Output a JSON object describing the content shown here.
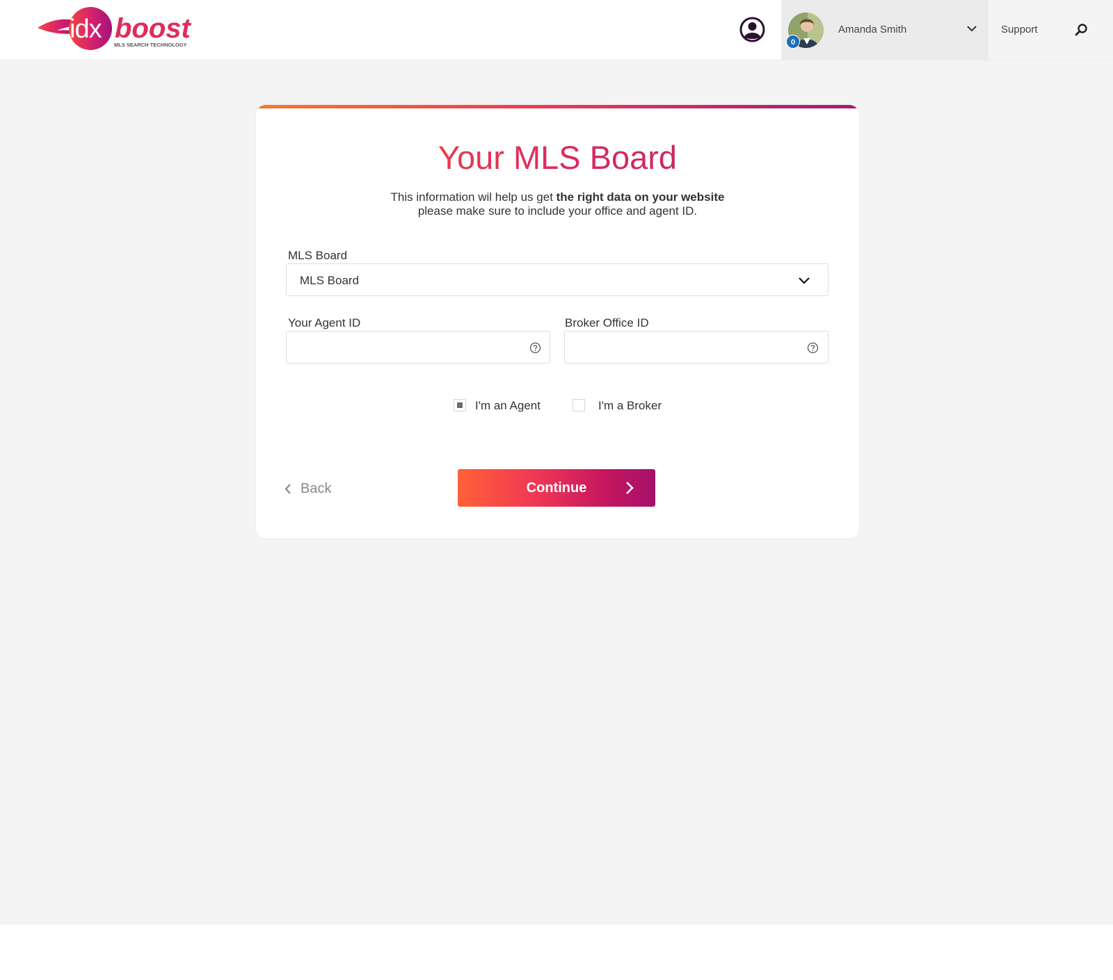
{
  "header": {
    "logo": {
      "wordmark_left": "idx",
      "wordmark_right": "boost",
      "tagline": "MLS SEARCH TECHNOLOGY"
    },
    "account_icon": "user-circle-icon",
    "user": {
      "name": "Amanda Smith",
      "notification_count": "0"
    },
    "support_label": "Support",
    "search_icon": "search-icon"
  },
  "card": {
    "title": "Your MLS Board",
    "description_part1": "This information wil help us get ",
    "description_bold": "the right data on your website",
    "description_line2": "please make sure to include your office and agent ID.",
    "mls_board": {
      "label": "MLS Board",
      "selected": "MLS Board"
    },
    "agent_id": {
      "label": "Your Agent ID",
      "value": ""
    },
    "broker_office_id": {
      "label": "Broker Office ID",
      "value": ""
    },
    "role_options": [
      {
        "label": "I'm an Agent",
        "checked": true
      },
      {
        "label": "I'm a Broker",
        "checked": false
      }
    ],
    "back_label": "Back",
    "continue_label": "Continue"
  },
  "colors": {
    "brand_gradient_start": "#ff6137",
    "brand_gradient_mid": "#ef3755",
    "brand_gradient_end": "#a4116b",
    "page_background": "#f4f4f4",
    "badge_blue": "#1c6fb6"
  }
}
